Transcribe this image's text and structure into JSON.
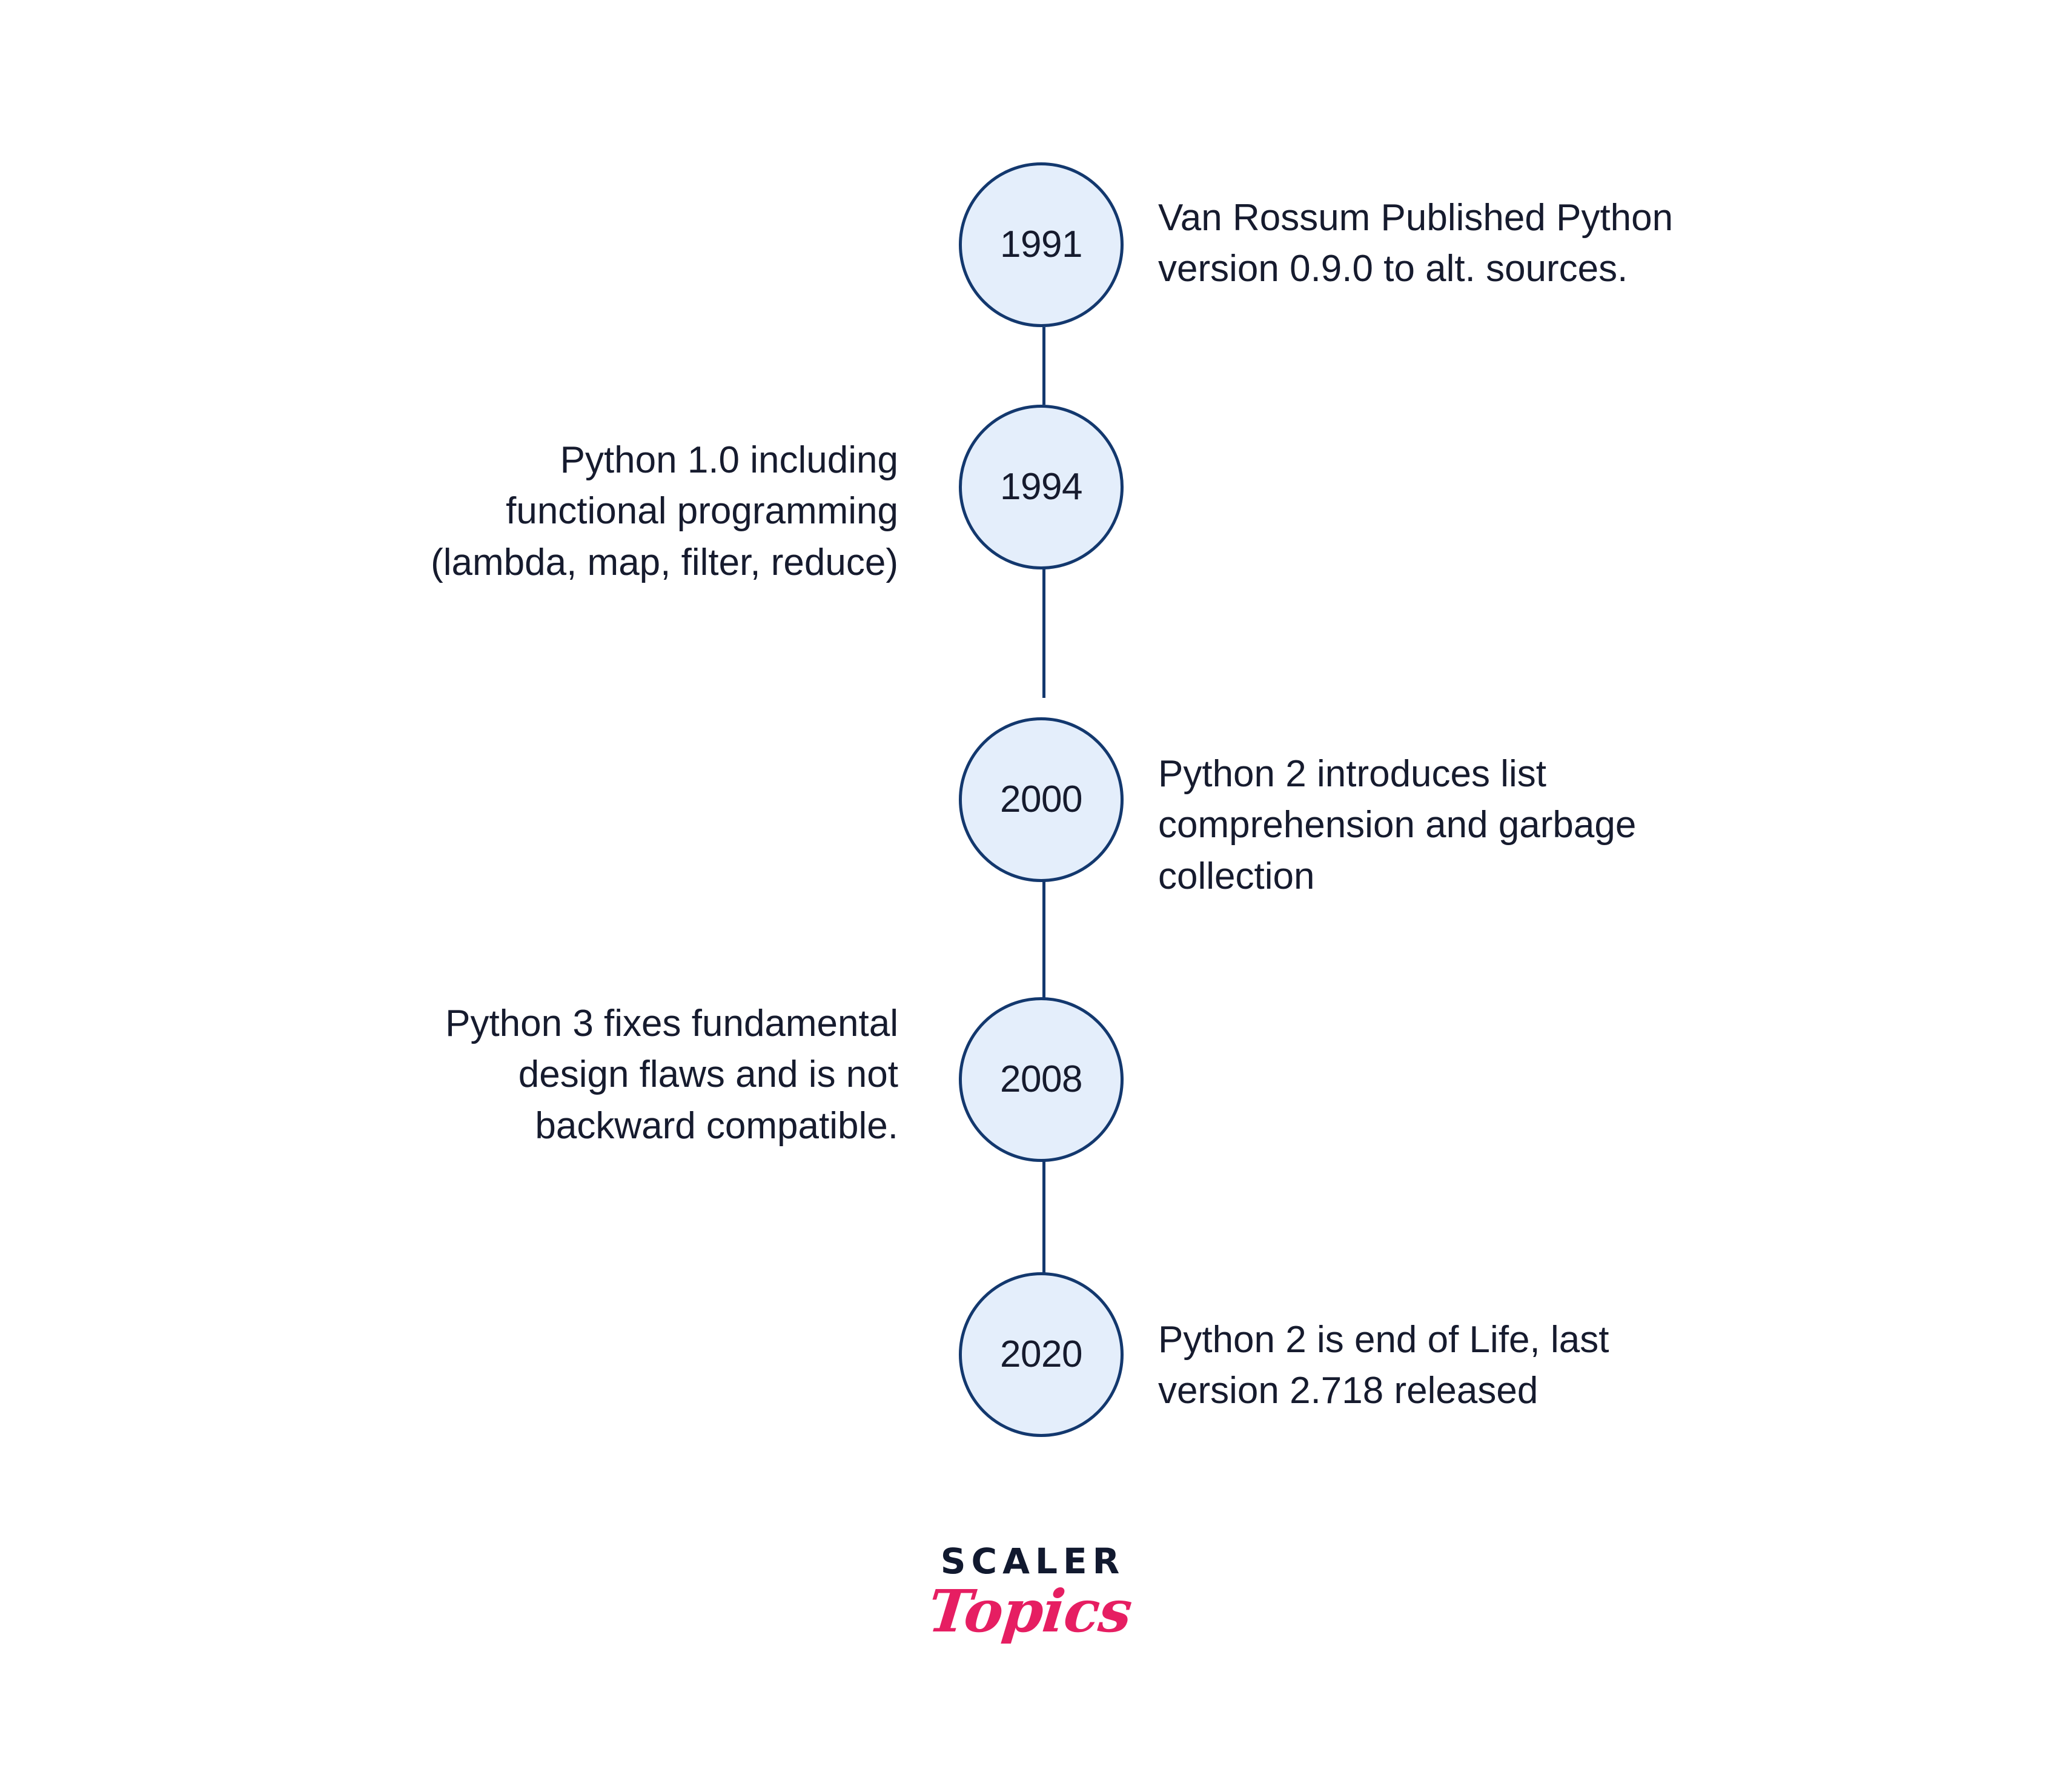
{
  "figure": {
    "kind": "vertical-timeline",
    "title_visible": false,
    "background_color": "#ffffff",
    "node_fill_color": "#e4eefb",
    "node_border_color": "#13386e",
    "text_color": "#161b2e"
  },
  "timeline": {
    "events": [
      {
        "year": "1991",
        "side": "right",
        "text": "Van Rossum Published Python\nversion 0.9.0 to alt. sources."
      },
      {
        "year": "1994",
        "side": "left",
        "text": "Python 1.0 including\nfunctional programming\n(lambda, map, filter, reduce)"
      },
      {
        "year": "2000",
        "side": "right",
        "text": "Python 2 introduces list\ncomprehension and garbage\ncollection"
      },
      {
        "year": "2008",
        "side": "left",
        "text": "Python 3 fixes fundamental\ndesign flaws and is not\nbackward compatible."
      },
      {
        "year": "2020",
        "side": "right",
        "text": "Python 2 is end of Life, last\nversion 2.718 released"
      }
    ]
  },
  "brand": {
    "primary": "SCALER",
    "secondary": "Topics",
    "primary_color": "#11192f",
    "secondary_color": "#e61e62"
  }
}
